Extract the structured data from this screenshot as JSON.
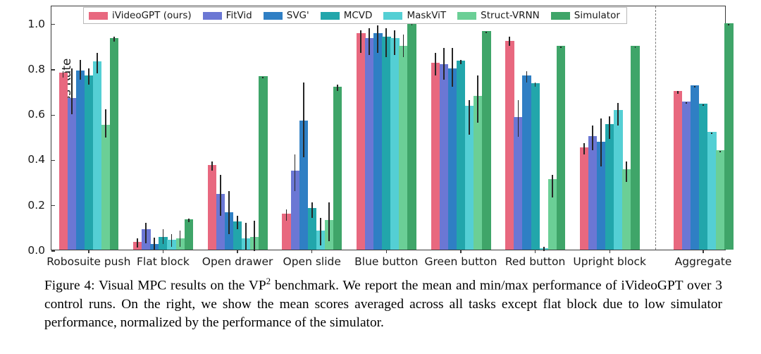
{
  "figure": {
    "y_axis_title": "Success Rate",
    "y_ticks": [
      "0.0",
      "0.2",
      "0.4",
      "0.6",
      "0.8",
      "1.0"
    ],
    "x_ticks": [
      "Robosuite push",
      "Flat block",
      "Open drawer",
      "Open slide",
      "Blue button",
      "Green button",
      "Red button",
      "Upright block",
      "Aggregate"
    ],
    "legend": [
      {
        "label": "iVideoGPT (ours)",
        "color": "#e8687f"
      },
      {
        "label": "FitVid",
        "color": "#6b77d4"
      },
      {
        "label": "SVG'",
        "color": "#2f7fc4"
      },
      {
        "label": "MCVD",
        "color": "#22a6ab"
      },
      {
        "label": "MaskViT",
        "color": "#54cfd4"
      },
      {
        "label": "Struct-VRNN",
        "color": "#6bcf96"
      },
      {
        "label": "Simulator",
        "color": "#3fa569"
      }
    ]
  },
  "caption": {
    "prefix": "Figure 4:",
    "line1": "Visual MPC results on the VP",
    "sup": "2",
    "line2": "benchmark. We report the mean and min/max performance of iVideoGPT over 3 control runs. On the right, we show the mean scores averaged across all tasks except flat block due to low simulator performance, normalized by the performance of the simulator."
  },
  "chart_data": {
    "type": "bar",
    "title": "",
    "xlabel": "",
    "ylabel": "Success Rate",
    "ylim": [
      0.0,
      1.08
    ],
    "yticks": [
      0.0,
      0.2,
      0.4,
      0.6,
      0.8,
      1.0
    ],
    "grid": false,
    "legend_position": "upper center (inside axes)",
    "categories": [
      "Robosuite push",
      "Flat block",
      "Open drawer",
      "Open slide",
      "Blue button",
      "Green button",
      "Red button",
      "Upright block",
      "Aggregate"
    ],
    "separator_after_category": "Upright block",
    "series": [
      {
        "name": "iVideoGPT (ours)",
        "color": "#e8687f",
        "values": [
          0.78,
          0.035,
          0.375,
          0.16,
          0.955,
          0.825,
          0.92,
          0.45,
          0.7
        ],
        "err_low": [
          0.765,
          0.015,
          0.355,
          0.135,
          0.875,
          0.775,
          0.905,
          0.425,
          0.695
        ],
        "err_high": [
          0.795,
          0.055,
          0.395,
          0.185,
          0.975,
          0.875,
          0.945,
          0.475,
          0.705
        ]
      },
      {
        "name": "FitVid",
        "color": "#6b77d4",
        "values": [
          0.67,
          0.09,
          0.245,
          0.35,
          0.935,
          0.82,
          0.585,
          0.5,
          0.655
        ],
        "err_low": [
          0.605,
          0.035,
          0.155,
          0.265,
          0.865,
          0.755,
          0.505,
          0.445,
          0.652
        ],
        "err_high": [
          0.805,
          0.125,
          0.335,
          0.425,
          0.985,
          0.895,
          0.665,
          0.555,
          0.658
        ]
      },
      {
        "name": "SVG'",
        "color": "#2f7fc4",
        "values": [
          0.79,
          0.025,
          0.165,
          0.57,
          0.955,
          0.8,
          0.77,
          0.475,
          0.725
        ],
        "err_low": [
          0.755,
          0.005,
          0.075,
          0.415,
          0.875,
          0.725,
          0.745,
          0.375,
          0.722
        ],
        "err_high": [
          0.845,
          0.06,
          0.265,
          0.745,
          0.995,
          0.895,
          0.795,
          0.585,
          0.728
        ]
      },
      {
        "name": "MCVD",
        "color": "#22a6ab",
        "values": [
          0.77,
          0.055,
          0.125,
          0.185,
          0.94,
          0.835,
          0.735,
          0.555,
          0.645
        ],
        "err_low": [
          0.735,
          0.03,
          0.095,
          0.145,
          0.855,
          0.825,
          0.725,
          0.495,
          0.642
        ],
        "err_high": [
          0.805,
          0.095,
          0.155,
          0.215,
          0.985,
          0.845,
          0.745,
          0.595,
          0.648
        ]
      },
      {
        "name": "MaskViT",
        "color": "#54cfd4",
        "values": [
          0.83,
          0.045,
          0.05,
          0.085,
          0.935,
          0.635,
          0.005,
          0.615,
          0.52
        ],
        "err_low": [
          0.785,
          0.02,
          0.005,
          0.025,
          0.865,
          0.515,
          0.0,
          0.555,
          0.517
        ],
        "err_high": [
          0.875,
          0.075,
          0.125,
          0.145,
          0.975,
          0.665,
          0.02,
          0.655,
          0.523
        ]
      },
      {
        "name": "Struct-VRNN",
        "color": "#6bcf96",
        "values": [
          0.55,
          0.05,
          0.055,
          0.13,
          0.9,
          0.68,
          0.31,
          0.355,
          0.44
        ],
        "err_low": [
          0.5,
          0.02,
          0.0,
          0.045,
          0.855,
          0.565,
          0.235,
          0.305,
          0.437
        ],
        "err_high": [
          0.625,
          0.09,
          0.135,
          0.215,
          0.955,
          0.775,
          0.335,
          0.395,
          0.443
        ]
      },
      {
        "name": "Simulator",
        "color": "#3fa569",
        "values": [
          0.935,
          0.135,
          0.765,
          0.72,
          1.0,
          0.965,
          0.9,
          0.9,
          1.0
        ],
        "err_low": [
          0.925,
          0.128,
          0.762,
          0.705,
          0.998,
          0.962,
          0.897,
          0.897,
          0.998
        ],
        "err_high": [
          0.945,
          0.142,
          0.768,
          0.735,
          1.002,
          0.968,
          0.903,
          0.903,
          1.002
        ]
      }
    ]
  }
}
